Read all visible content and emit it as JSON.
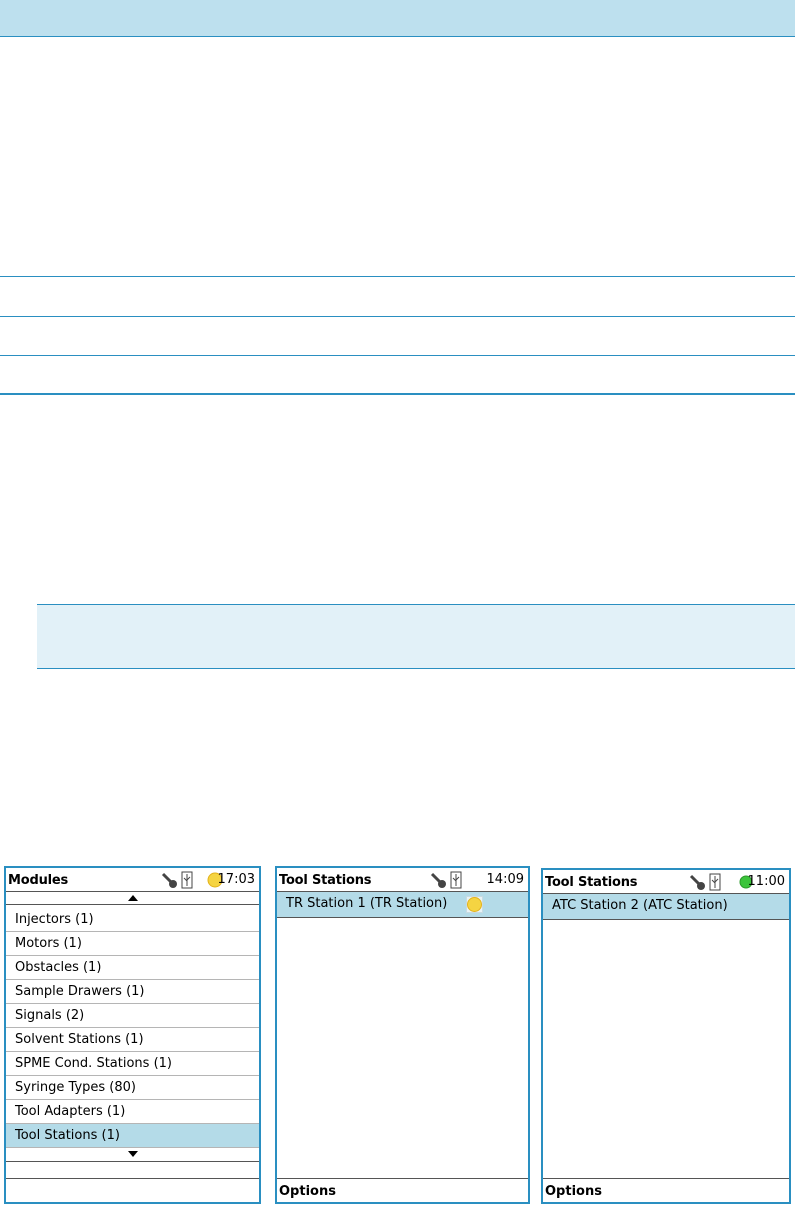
{
  "screens": [
    {
      "title": "Modules",
      "time": "17:03",
      "status_icon": "yellow-status-icon",
      "items": [
        "Injectors (1)",
        "Motors (1)",
        "Obstacles (1)",
        "Sample Drawers (1)",
        "Signals (2)",
        "Solvent Stations (1)",
        "SPME Cond. Stations (1)",
        "Syringe Types (80)",
        "Tool Adapters (1)",
        "Tool Stations (1)"
      ],
      "selected_index": 9
    },
    {
      "title": "Tool Stations",
      "time": "14:09",
      "items": [
        "TR Station 1 (TR Station)"
      ],
      "item_status_icon": "yellow-status-icon",
      "footer": "Options"
    },
    {
      "title": "Tool Stations",
      "time": "11:00",
      "status_icon": "green-status-icon",
      "items": [
        "ATC Station 2 (ATC Station)"
      ],
      "footer": "Options"
    }
  ],
  "colors": {
    "accent": "#2a8fc1",
    "header_bg": "#bde0ee",
    "selected_bg": "#b4dbe8",
    "yellow": "#f5d442",
    "green": "#3cc43c"
  }
}
